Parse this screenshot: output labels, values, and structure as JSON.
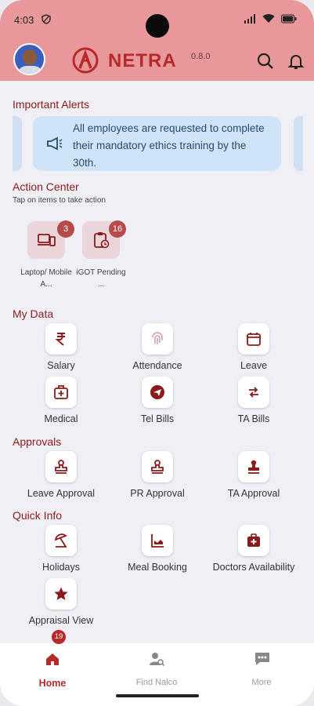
{
  "status": {
    "time": "4:03"
  },
  "header": {
    "brand": "NETRA",
    "version": "0.8.0"
  },
  "alerts": {
    "title": "Important Alerts",
    "message": "All employees are requested to complete their mandatory ethics training by the 30th."
  },
  "action_center": {
    "title": "Action Center",
    "subtitle": "Tap on items to take action",
    "items": [
      {
        "label": "Laptop/ Mobile A...",
        "count": "3",
        "icon": "laptop-mobile-icon"
      },
      {
        "label": "iGOT Pending ...",
        "count": "16",
        "icon": "clipboard-icon"
      }
    ]
  },
  "my_data": {
    "title": "My Data",
    "items": [
      {
        "label": "Salary",
        "icon": "rupee-icon"
      },
      {
        "label": "Attendance",
        "icon": "fingerprint-icon"
      },
      {
        "label": "Leave",
        "icon": "calendar-icon"
      },
      {
        "label": "Medical",
        "icon": "medical-kit-icon"
      },
      {
        "label": "Tel Bills",
        "icon": "telegram-icon"
      },
      {
        "label": "TA Bills",
        "icon": "exchange-icon"
      }
    ]
  },
  "approvals": {
    "title": "Approvals",
    "items": [
      {
        "label": "Leave Approval",
        "icon": "stamp-icon"
      },
      {
        "label": "PR Approval",
        "icon": "stamp-icon"
      },
      {
        "label": "TA Approval",
        "icon": "stamp-icon"
      }
    ]
  },
  "quick_info": {
    "title": "Quick Info",
    "items": [
      {
        "label": "Holidays",
        "icon": "beach-umbrella-icon"
      },
      {
        "label": "Meal Booking",
        "icon": "meal-chart-icon"
      },
      {
        "label": "Doctors Availability",
        "icon": "doctor-kit-icon"
      },
      {
        "label": "Appraisal View",
        "icon": "star-icon"
      }
    ]
  },
  "bottom_nav": {
    "badge": "19",
    "items": [
      {
        "label": "Home",
        "icon": "home-icon",
        "active": true
      },
      {
        "label": "Find Nalco",
        "icon": "find-person-icon",
        "active": false
      },
      {
        "label": "More",
        "icon": "chat-dots-icon",
        "active": false
      }
    ]
  },
  "colors": {
    "header_bg": "#e8989a",
    "accent": "#b72a2a",
    "alert_bg": "#cfe4f7",
    "page_bg": "#f1eff6"
  }
}
